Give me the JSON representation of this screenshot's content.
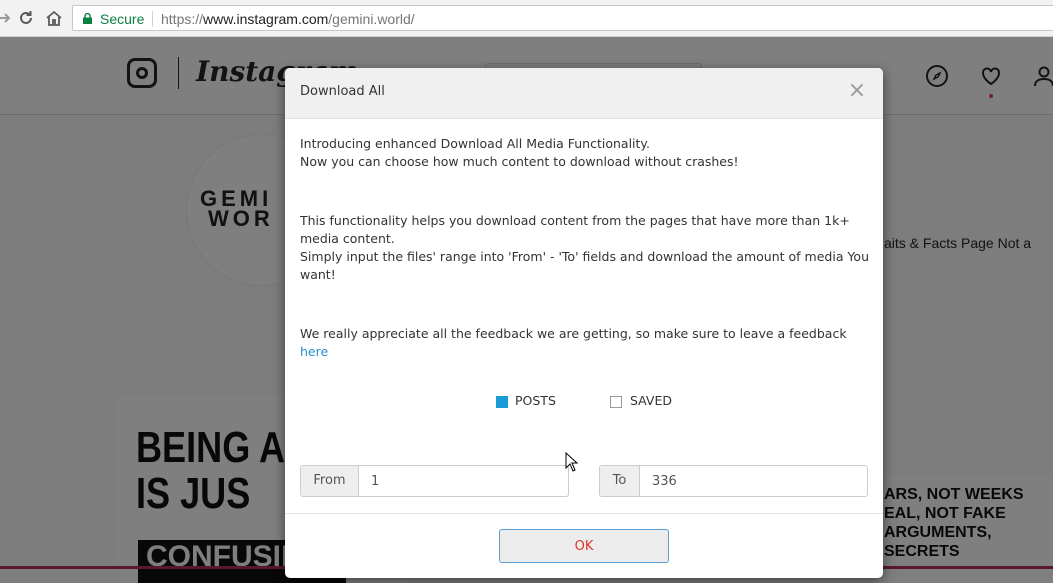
{
  "browser": {
    "secure_label": "Secure",
    "url_scheme": "https://",
    "url_host": "www.instagram.com",
    "url_path": "/gemini.world/"
  },
  "page": {
    "wordmark": "Instagram",
    "profile_pic_text_line1": "GEMI",
    "profile_pic_text_line2": "WOR",
    "bio_fragment": "aits & Facts Page Not a",
    "post_left_text": "BEING A C\nIS JUS",
    "post_left_box": "CONFUSIN",
    "post_right_text": "ARS, NOT WEEKS\nEAL, NOT FAKE\nARGUMENTS,\nSECRETS"
  },
  "dialog": {
    "title": "Download All",
    "close_glyph": "×",
    "intro_line1": "Introducing enhanced Download All Media Functionality.",
    "intro_line2": "Now you can choose how much content to download without crashes!",
    "desc_line1": "This functionality helps you download content from the pages that have more than 1k+ media content.",
    "desc_line2": "Simply input the files' range into 'From' - 'To' fields and download the amount of media You want!",
    "feedback_text": "We really appreciate all the feedback we are getting, so make sure to leave a feedback ",
    "feedback_link": "here",
    "options": [
      {
        "label": "POSTS",
        "checked": true
      },
      {
        "label": "SAVED",
        "checked": false
      }
    ],
    "from_label": "From",
    "from_value": "1",
    "to_label": "To",
    "to_value": "336",
    "ok_label": "OK"
  },
  "colors": {
    "secure_green": "#0b8043",
    "link_blue": "#2a8fc9",
    "checkbox_blue": "#1a9bd7",
    "ok_text_red": "#d9342b"
  }
}
